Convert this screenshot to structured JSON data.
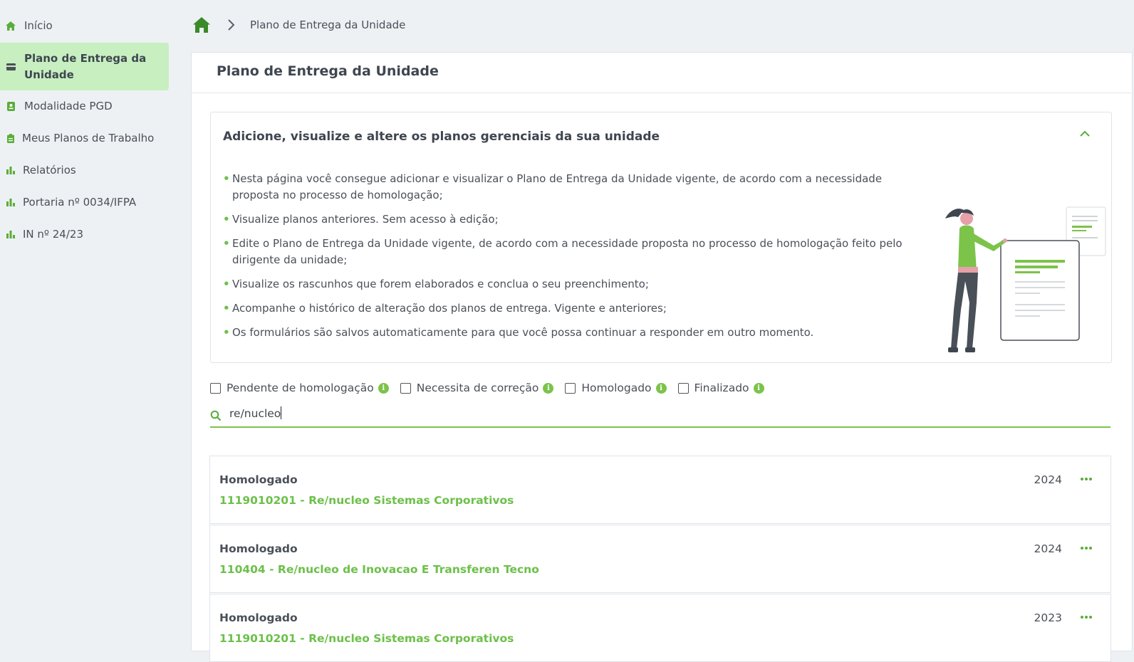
{
  "sidebar": {
    "items": [
      {
        "label": "Início",
        "icon": "home-icon"
      },
      {
        "label": "Plano de Entrega da Unidade",
        "icon": "card-icon",
        "active": true
      },
      {
        "label": "Modalidade PGD",
        "icon": "badge-icon"
      },
      {
        "label": "Meus Planos de Trabalho",
        "icon": "clipboard-icon"
      },
      {
        "label": "Relatórios",
        "icon": "bar-chart-icon"
      },
      {
        "label": "Portaria nº 0034/IFPA",
        "icon": "bar-chart-icon"
      },
      {
        "label": "IN nº 24/23",
        "icon": "bar-chart-icon"
      }
    ]
  },
  "breadcrumb": {
    "current": "Plano de Entrega da Unidade"
  },
  "page": {
    "title": "Plano de Entrega da Unidade"
  },
  "info": {
    "title": "Adicione, visualize e altere os planos gerenciais da sua unidade",
    "bullets": [
      "Nesta página você consegue adicionar e visualizar o Plano de Entrega da Unidade vigente, de acordo com a necessidade proposta no processo de homologação;",
      "Visualize planos anteriores. Sem acesso à edição;",
      "Edite o Plano de Entrega da Unidade vigente, de acordo com a necessidade proposta no processo de homologação feito pelo dirigente da unidade;",
      "Visualize os rascunhos que forem elaborados e conclua o seu preenchimento;",
      "Acompanhe o histórico de alteração dos planos de entrega. Vigente e anteriores;",
      "Os formulários são salvos automaticamente para que você possa continuar a responder em outro momento."
    ]
  },
  "filters": [
    {
      "label": "Pendente de homologação",
      "checked": false
    },
    {
      "label": "Necessita de correção",
      "checked": false
    },
    {
      "label": "Homologado",
      "checked": false
    },
    {
      "label": "Finalizado",
      "checked": false
    }
  ],
  "search": {
    "value": "re/nucleo"
  },
  "rows": [
    {
      "status": "Homologado",
      "name": "1119010201 - Re/nucleo Sistemas Corporativos",
      "year": "2024"
    },
    {
      "status": "Homologado",
      "name": "110404 - Re/nucleo de Inovacao E Transferen Tecno",
      "year": "2024"
    },
    {
      "status": "Homologado",
      "name": "1119010201 - Re/nucleo Sistemas Corporativos",
      "year": "2023"
    }
  ],
  "colors": {
    "accent": "#7cc34a",
    "active_bg": "#c7efc0",
    "link": "#6cc04a"
  }
}
